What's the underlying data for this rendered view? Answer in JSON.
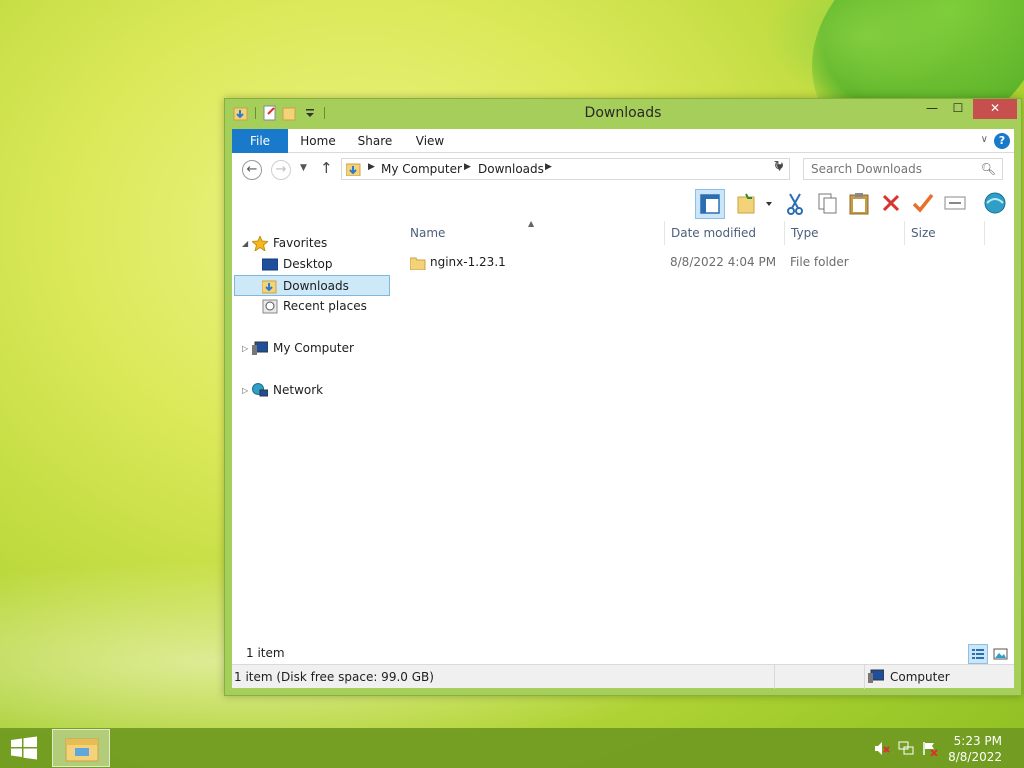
{
  "window": {
    "title": "Downloads",
    "controls": {
      "minimize": "—",
      "maximize": "☐",
      "close": "✕"
    }
  },
  "ribbon": {
    "tabs": [
      "File",
      "Home",
      "Share",
      "View"
    ],
    "help": "?"
  },
  "address": {
    "breadcrumb": [
      "My Computer",
      "Downloads"
    ]
  },
  "search": {
    "placeholder": "Search Downloads"
  },
  "nav_pane": {
    "favorites_label": "Favorites",
    "favorites": [
      "Desktop",
      "Downloads",
      "Recent places"
    ],
    "selected": "Downloads",
    "computer_label": "My Computer",
    "network_label": "Network"
  },
  "file_list": {
    "columns": [
      "Name",
      "Date modified",
      "Type",
      "Size"
    ],
    "rows": [
      {
        "name": "nginx-1.23.1",
        "date_modified": "8/8/2022 4:04 PM",
        "type": "File folder",
        "size": ""
      }
    ]
  },
  "status": {
    "item_count": "1 item",
    "details_text": "1 item (Disk free space: 99.0 GB)",
    "location": "Computer"
  },
  "taskbar": {
    "time": "5:23 PM",
    "date": "8/8/2022"
  },
  "colors": {
    "window_frame": "#a5cf5a",
    "file_tab": "#1979ca",
    "close_button": "#c7504f",
    "selection": "#cde8f7"
  }
}
